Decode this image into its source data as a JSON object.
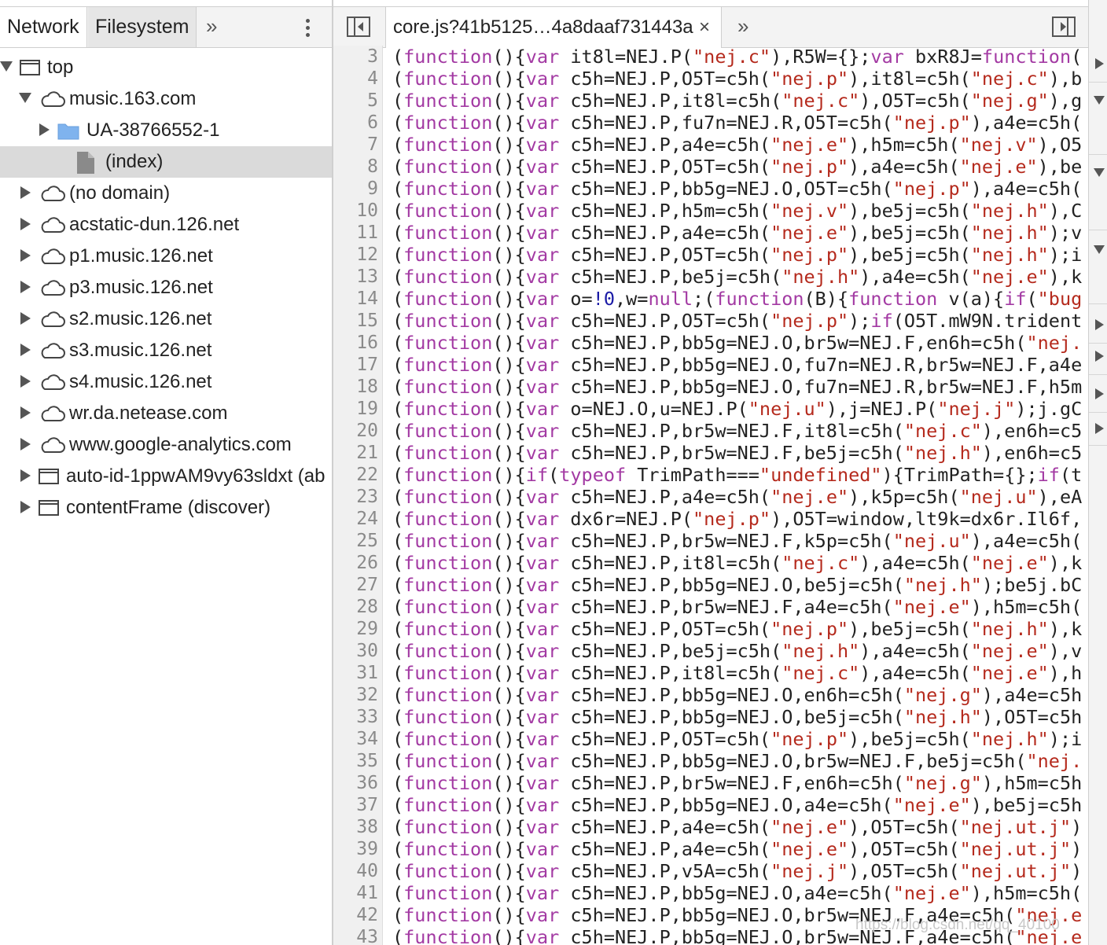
{
  "left_panel": {
    "tabs": [
      {
        "label": "Network"
      },
      {
        "label": "Filesystem"
      }
    ],
    "more_label": "»"
  },
  "tree": {
    "items": [
      {
        "label": "top",
        "icon": "frame-icon",
        "arrow": "down",
        "level": 0,
        "selected": false
      },
      {
        "label": "music.163.com",
        "icon": "cloud-icon",
        "arrow": "down",
        "level": 1,
        "selected": false
      },
      {
        "label": "UA-38766552-1",
        "icon": "folder-icon",
        "arrow": "right",
        "level": 2,
        "selected": false
      },
      {
        "label": "(index)",
        "icon": "file-icon",
        "arrow": "none",
        "level": 3,
        "selected": true
      },
      {
        "label": "(no domain)",
        "icon": "cloud-icon",
        "arrow": "right",
        "level": 1,
        "selected": false
      },
      {
        "label": "acstatic-dun.126.net",
        "icon": "cloud-icon",
        "arrow": "right",
        "level": 1,
        "selected": false
      },
      {
        "label": "p1.music.126.net",
        "icon": "cloud-icon",
        "arrow": "right",
        "level": 1,
        "selected": false
      },
      {
        "label": "p3.music.126.net",
        "icon": "cloud-icon",
        "arrow": "right",
        "level": 1,
        "selected": false
      },
      {
        "label": "s2.music.126.net",
        "icon": "cloud-icon",
        "arrow": "right",
        "level": 1,
        "selected": false
      },
      {
        "label": "s3.music.126.net",
        "icon": "cloud-icon",
        "arrow": "right",
        "level": 1,
        "selected": false
      },
      {
        "label": "s4.music.126.net",
        "icon": "cloud-icon",
        "arrow": "right",
        "level": 1,
        "selected": false
      },
      {
        "label": "wr.da.netease.com",
        "icon": "cloud-icon",
        "arrow": "right",
        "level": 1,
        "selected": false
      },
      {
        "label": "www.google-analytics.com",
        "icon": "cloud-icon",
        "arrow": "right",
        "level": 1,
        "selected": false
      },
      {
        "label": "auto-id-1ppwAM9vy63sldxt (ab",
        "icon": "frame-icon",
        "arrow": "right",
        "level": 1,
        "selected": false
      },
      {
        "label": "contentFrame (discover)",
        "icon": "frame-icon",
        "arrow": "right",
        "level": 1,
        "selected": false
      }
    ]
  },
  "editor": {
    "file_tab": "core.js?41b5125…4a8daaf731443a",
    "close_label": "×",
    "more_label": "»",
    "lines": [
      {
        "n": "3",
        "text": "(function(){var it8l=NEJ.P(\"nej.c\"),R5W={};var bxR8J=function("
      },
      {
        "n": "4",
        "text": "(function(){var c5h=NEJ.P,O5T=c5h(\"nej.p\"),it8l=c5h(\"nej.c\"),b"
      },
      {
        "n": "5",
        "text": "(function(){var c5h=NEJ.P,it8l=c5h(\"nej.c\"),O5T=c5h(\"nej.g\"),g"
      },
      {
        "n": "6",
        "text": "(function(){var c5h=NEJ.P,fu7n=NEJ.R,O5T=c5h(\"nej.p\"),a4e=c5h("
      },
      {
        "n": "7",
        "text": "(function(){var c5h=NEJ.P,a4e=c5h(\"nej.e\"),h5m=c5h(\"nej.v\"),O5"
      },
      {
        "n": "8",
        "text": "(function(){var c5h=NEJ.P,O5T=c5h(\"nej.p\"),a4e=c5h(\"nej.e\"),be"
      },
      {
        "n": "9",
        "text": "(function(){var c5h=NEJ.P,bb5g=NEJ.O,O5T=c5h(\"nej.p\"),a4e=c5h("
      },
      {
        "n": "10",
        "text": "(function(){var c5h=NEJ.P,h5m=c5h(\"nej.v\"),be5j=c5h(\"nej.h\"),C"
      },
      {
        "n": "11",
        "text": "(function(){var c5h=NEJ.P,a4e=c5h(\"nej.e\"),be5j=c5h(\"nej.h\");v"
      },
      {
        "n": "12",
        "text": "(function(){var c5h=NEJ.P,O5T=c5h(\"nej.p\"),be5j=c5h(\"nej.h\");i"
      },
      {
        "n": "13",
        "text": "(function(){var c5h=NEJ.P,be5j=c5h(\"nej.h\"),a4e=c5h(\"nej.e\"),k"
      },
      {
        "n": "14",
        "text": "(function(){var o=!0,w=null;(function(B){function v(a){if(\"bug"
      },
      {
        "n": "15",
        "text": "(function(){var c5h=NEJ.P,O5T=c5h(\"nej.p\");if(O5T.mW9N.trident"
      },
      {
        "n": "16",
        "text": "(function(){var c5h=NEJ.P,bb5g=NEJ.O,br5w=NEJ.F,en6h=c5h(\"nej."
      },
      {
        "n": "17",
        "text": "(function(){var c5h=NEJ.P,bb5g=NEJ.O,fu7n=NEJ.R,br5w=NEJ.F,a4e"
      },
      {
        "n": "18",
        "text": "(function(){var c5h=NEJ.P,bb5g=NEJ.O,fu7n=NEJ.R,br5w=NEJ.F,h5m"
      },
      {
        "n": "19",
        "text": "(function(){var o=NEJ.O,u=NEJ.P(\"nej.u\"),j=NEJ.P(\"nej.j\");j.gC"
      },
      {
        "n": "20",
        "text": "(function(){var c5h=NEJ.P,br5w=NEJ.F,it8l=c5h(\"nej.c\"),en6h=c5"
      },
      {
        "n": "21",
        "text": "(function(){var c5h=NEJ.P,br5w=NEJ.F,be5j=c5h(\"nej.h\"),en6h=c5"
      },
      {
        "n": "22",
        "text": "(function(){if(typeof TrimPath===\"undefined\"){TrimPath={};if(t"
      },
      {
        "n": "23",
        "text": "(function(){var c5h=NEJ.P,a4e=c5h(\"nej.e\"),k5p=c5h(\"nej.u\"),eA"
      },
      {
        "n": "24",
        "text": "(function(){var dx6r=NEJ.P(\"nej.p\"),O5T=window,lt9k=dx6r.Il6f,"
      },
      {
        "n": "25",
        "text": "(function(){var c5h=NEJ.P,br5w=NEJ.F,k5p=c5h(\"nej.u\"),a4e=c5h("
      },
      {
        "n": "26",
        "text": "(function(){var c5h=NEJ.P,it8l=c5h(\"nej.c\"),a4e=c5h(\"nej.e\"),k"
      },
      {
        "n": "27",
        "text": "(function(){var c5h=NEJ.P,bb5g=NEJ.O,be5j=c5h(\"nej.h\");be5j.bC"
      },
      {
        "n": "28",
        "text": "(function(){var c5h=NEJ.P,br5w=NEJ.F,a4e=c5h(\"nej.e\"),h5m=c5h("
      },
      {
        "n": "29",
        "text": "(function(){var c5h=NEJ.P,O5T=c5h(\"nej.p\"),be5j=c5h(\"nej.h\"),k"
      },
      {
        "n": "30",
        "text": "(function(){var c5h=NEJ.P,be5j=c5h(\"nej.h\"),a4e=c5h(\"nej.e\"),v"
      },
      {
        "n": "31",
        "text": "(function(){var c5h=NEJ.P,it8l=c5h(\"nej.c\"),a4e=c5h(\"nej.e\"),h"
      },
      {
        "n": "32",
        "text": "(function(){var c5h=NEJ.P,bb5g=NEJ.O,en6h=c5h(\"nej.g\"),a4e=c5h"
      },
      {
        "n": "33",
        "text": "(function(){var c5h=NEJ.P,bb5g=NEJ.O,be5j=c5h(\"nej.h\"),O5T=c5h"
      },
      {
        "n": "34",
        "text": "(function(){var c5h=NEJ.P,O5T=c5h(\"nej.p\"),be5j=c5h(\"nej.h\");i"
      },
      {
        "n": "35",
        "text": "(function(){var c5h=NEJ.P,bb5g=NEJ.O,br5w=NEJ.F,be5j=c5h(\"nej."
      },
      {
        "n": "36",
        "text": "(function(){var c5h=NEJ.P,br5w=NEJ.F,en6h=c5h(\"nej.g\"),h5m=c5h"
      },
      {
        "n": "37",
        "text": "(function(){var c5h=NEJ.P,bb5g=NEJ.O,a4e=c5h(\"nej.e\"),be5j=c5h"
      },
      {
        "n": "38",
        "text": "(function(){var c5h=NEJ.P,a4e=c5h(\"nej.e\"),O5T=c5h(\"nej.ut.j\")"
      },
      {
        "n": "39",
        "text": "(function(){var c5h=NEJ.P,a4e=c5h(\"nej.e\"),O5T=c5h(\"nej.ut.j\")"
      },
      {
        "n": "40",
        "text": "(function(){var c5h=NEJ.P,v5A=c5h(\"nej.j\"),O5T=c5h(\"nej.ut.j\")"
      },
      {
        "n": "41",
        "text": "(function(){var c5h=NEJ.P,bb5g=NEJ.O,a4e=c5h(\"nej.e\"),h5m=c5h("
      },
      {
        "n": "42",
        "text": "(function(){var c5h=NEJ.P,bb5g=NEJ.O,br5w=NEJ.F,a4e=c5h(\"nej.e"
      },
      {
        "n": "43",
        "text": "(function(){var c5h=NEJ.P,bb5g=NEJ.O,br5w=NEJ.F,a4e=c5h(\"nej.e"
      }
    ]
  },
  "watermark": "https://blog.csdn.net/qq_40100"
}
